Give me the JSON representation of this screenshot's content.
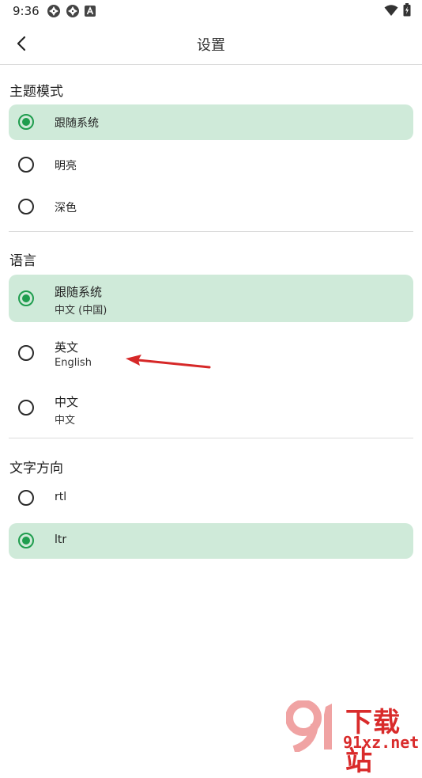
{
  "status_bar": {
    "time": "9:36"
  },
  "app_bar": {
    "title": "设置"
  },
  "theme_section": {
    "title": "主题模式",
    "options": [
      {
        "label": "跟随系统",
        "selected": true
      },
      {
        "label": "明亮",
        "selected": false
      },
      {
        "label": "深色",
        "selected": false
      }
    ]
  },
  "language_section": {
    "title": "语言",
    "options": [
      {
        "label": "跟随系统",
        "sublabel": "中文 (中国)",
        "selected": true
      },
      {
        "label": "英文",
        "sublabel": "English",
        "selected": false
      },
      {
        "label": "中文",
        "sublabel": "中文",
        "selected": false
      }
    ]
  },
  "direction_section": {
    "title": "文字方向",
    "options": [
      {
        "label": "rtl",
        "selected": false
      },
      {
        "label": "ltr",
        "selected": true
      }
    ]
  },
  "watermark": {
    "top": "下载站",
    "bottom": "91xz.net"
  },
  "colors": {
    "selected_bg": "#cfead9",
    "radio_active": "#1f9d4e",
    "annotation_arrow": "#d62828"
  }
}
